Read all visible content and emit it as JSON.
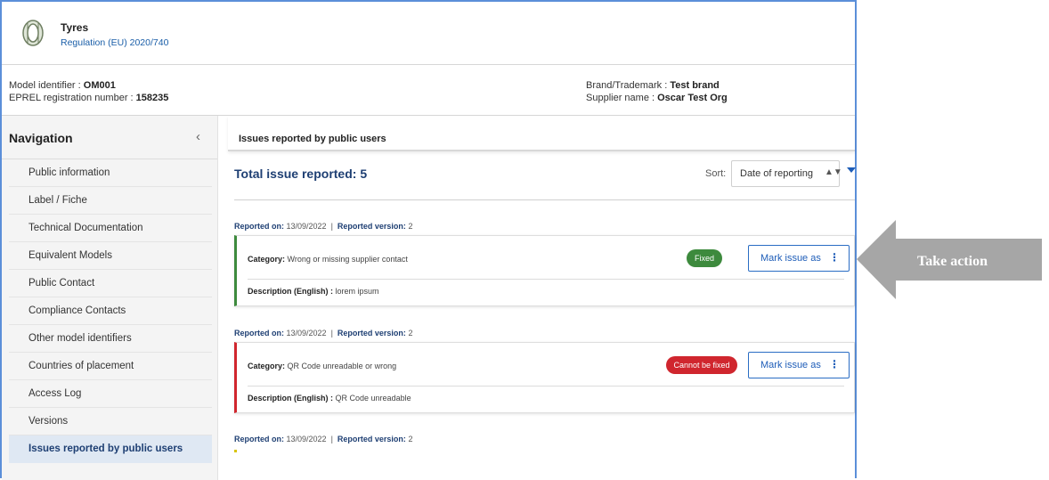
{
  "header": {
    "title": "Tyres",
    "subtitle": "Regulation (EU) 2020/740",
    "icon": "tyre-icon"
  },
  "info": {
    "model_identifier_label": "Model identifier : ",
    "model_identifier": "OM001",
    "registration_label": "EPREL registration number : ",
    "registration_number": "158235",
    "brand_label": "Brand/Trademark : ",
    "brand": "Test brand",
    "supplier_label": "Supplier name : ",
    "supplier": "Oscar Test Org"
  },
  "sidebar": {
    "title": "Navigation",
    "collapse_icon": "chevron-left-icon",
    "items": [
      {
        "label": "Public information"
      },
      {
        "label": "Label / Fiche"
      },
      {
        "label": "Technical Documentation"
      },
      {
        "label": "Equivalent Models"
      },
      {
        "label": "Public Contact"
      },
      {
        "label": "Compliance Contacts"
      },
      {
        "label": "Other model identifiers"
      },
      {
        "label": "Countries of placement"
      },
      {
        "label": "Access Log"
      },
      {
        "label": "Versions"
      },
      {
        "label": "Issues reported by public users",
        "active": true
      }
    ]
  },
  "main": {
    "section_title": "Issues reported by public users",
    "total_label": "Total issue reported: 5",
    "sort_label": "Sort:",
    "sort_value": "Date of reporting",
    "issues": [
      {
        "reported_on_label": "Reported on:",
        "reported_on": "13/09/2022",
        "version_label": "Reported version:",
        "version": "2",
        "category_label": "Category:",
        "category": "Wrong or missing supplier contact",
        "status": "Fixed",
        "status_color": "#3d8a3d",
        "action_label": "Mark issue as",
        "description_label": "Description (English) :",
        "description": "lorem ipsum"
      },
      {
        "reported_on_label": "Reported on:",
        "reported_on": "13/09/2022",
        "version_label": "Reported version:",
        "version": "2",
        "category_label": "Category:",
        "category": "QR Code unreadable or wrong",
        "status": "Cannot be fixed",
        "status_color": "#d0262e",
        "action_label": "Mark issue as",
        "description_label": "Description (English) :",
        "description": "QR Code unreadable"
      },
      {
        "reported_on_label": "Reported on:",
        "reported_on": "13/09/2022",
        "version_label": "Reported version:",
        "version": "2"
      }
    ]
  },
  "callout": {
    "text": "Take action",
    "color": "#a6a6a6"
  }
}
